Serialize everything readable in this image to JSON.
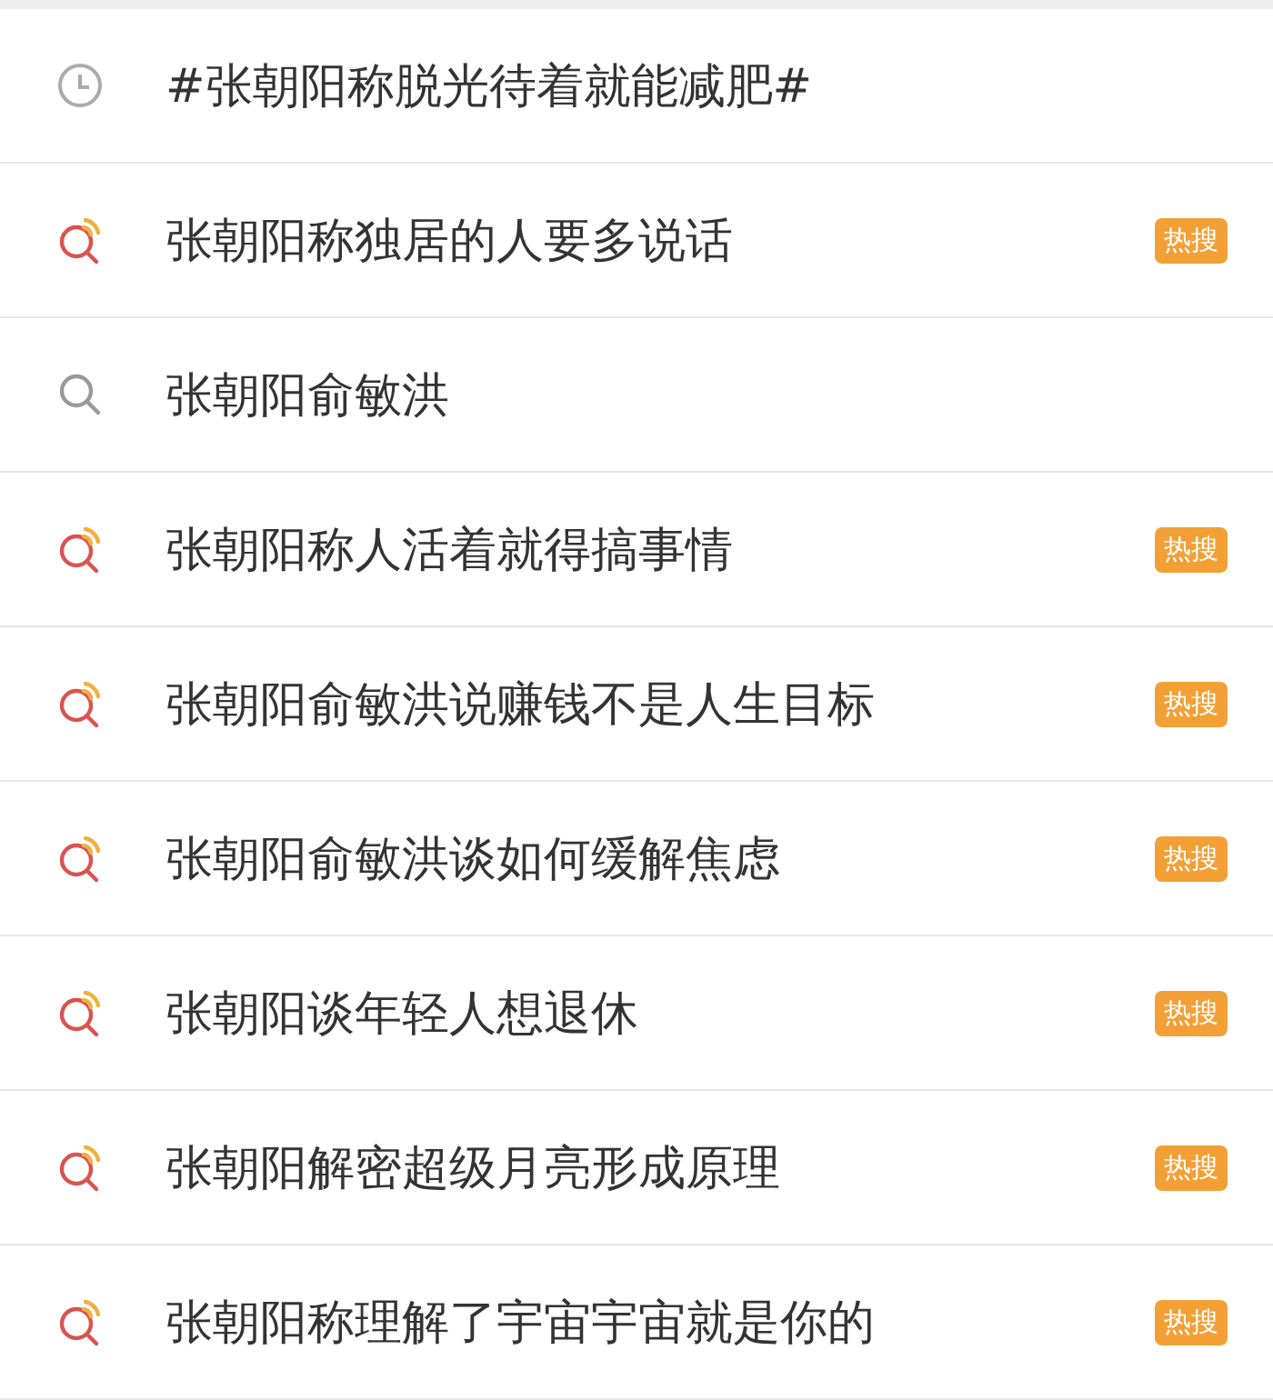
{
  "suggestions": [
    {
      "kind": "history",
      "text": "#张朝阳称脱光待着就能减肥#"
    },
    {
      "kind": "hot",
      "text": "张朝阳称独居的人要多说话",
      "badge": "热搜"
    },
    {
      "kind": "search",
      "text": "张朝阳俞敏洪"
    },
    {
      "kind": "hot",
      "text": "张朝阳称人活着就得搞事情",
      "badge": "热搜"
    },
    {
      "kind": "hot",
      "text": "张朝阳俞敏洪说赚钱不是人生目标",
      "badge": "热搜"
    },
    {
      "kind": "hot",
      "text": "张朝阳俞敏洪谈如何缓解焦虑",
      "badge": "热搜"
    },
    {
      "kind": "hot",
      "text": "张朝阳谈年轻人想退休",
      "badge": "热搜"
    },
    {
      "kind": "hot",
      "text": "张朝阳解密超级月亮形成原理",
      "badge": "热搜"
    },
    {
      "kind": "hot",
      "text": "张朝阳称理解了宇宙宇宙就是你的",
      "badge": "热搜"
    }
  ]
}
